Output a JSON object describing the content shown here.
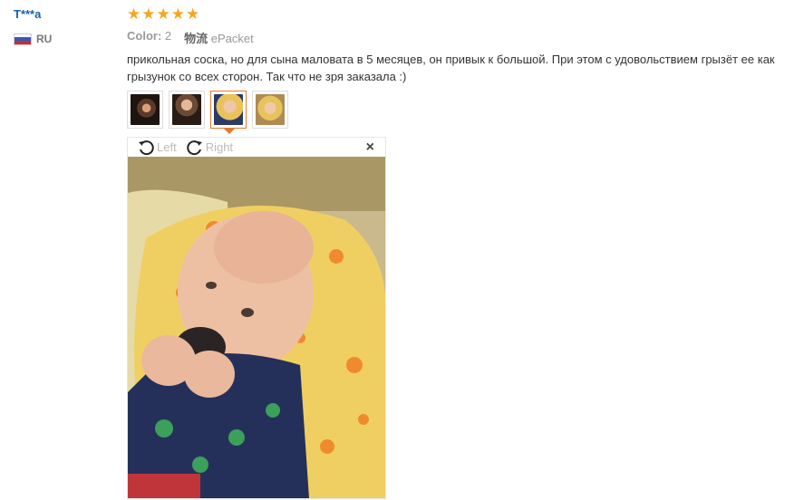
{
  "review": {
    "user": "T***a",
    "country_code": "RU",
    "stars": [
      "★",
      "★",
      "★",
      "★",
      "★"
    ],
    "color_label": "Color:",
    "color_value": "2",
    "shipping_label": "物流",
    "shipping_value": "ePacket",
    "text": "прикольная соска, но для сына маловата в 5 месяцев, он привык к большой. При этом с удовольствием грызёт ее как грызунок со всех сторон. Так что не зря заказала :)"
  },
  "thumbnails": [
    {
      "name": "photo-thumbnail-1",
      "active": false
    },
    {
      "name": "photo-thumbnail-2",
      "active": false
    },
    {
      "name": "photo-thumbnail-3",
      "active": true
    },
    {
      "name": "photo-thumbnail-4",
      "active": false
    }
  ],
  "viewer": {
    "rotate_left_label": "Left",
    "rotate_right_label": "Right",
    "close_glyph": "×"
  },
  "colors": {
    "star": "#f5a623",
    "username": "#1a5fa8",
    "active_border": "#e8792e"
  },
  "icons": [
    "flag-ru-icon",
    "star-icon",
    "rotate-left-icon",
    "rotate-right-icon",
    "close-icon"
  ]
}
